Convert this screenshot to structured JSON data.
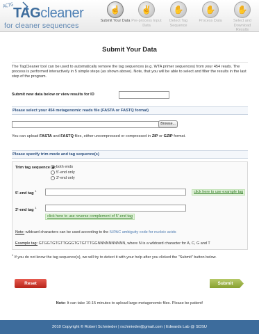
{
  "app": {
    "logo_seq": "ACTG",
    "logo_tag": "TAG",
    "logo_name": "cleaner",
    "logo_sub": "for cleaner sequences"
  },
  "steps": [
    {
      "label": "Submit Your Data",
      "icon": "hand-one-icon",
      "active": true
    },
    {
      "label": "Pre-process Input Data",
      "icon": "hand-two-icon",
      "active": false
    },
    {
      "label": "Detect Tag Sequence",
      "icon": "hand-three-icon",
      "active": false
    },
    {
      "label": "Process Data",
      "icon": "hand-four-icon",
      "active": false
    },
    {
      "label": "Select and Download Results",
      "icon": "hand-five-icon",
      "active": false
    }
  ],
  "page": {
    "title": "Submit Your Data",
    "intro": "The TagCleaner tool can be used to automatically remove the tag sequences (e.g. WTA primer sequences) from your 454 reads. The process is performed interactively in 5 simple steps (as shown above). Note, that you will be able to select and filter the results in the last step of the program.",
    "id_label": "Submit new data below or view results for ID",
    "id_value": ""
  },
  "file_section": {
    "header": "Please select your 454 metagenomic reads file (FASTA or FASTQ format)",
    "browse_label": "Browse...",
    "note_pre": "You can upload ",
    "note_fasta": "FASTA",
    "note_and": " and ",
    "note_fastq": "FASTQ",
    "note_mid": " files, either uncompressed or compressed in ",
    "note_zip": "ZIP",
    "note_or": " or ",
    "note_gzip": "GZIP",
    "note_end": " format."
  },
  "trim_section": {
    "header": "Please specify trim mode and tag sequence(s)",
    "trim_label": "Trim tag sequence at:",
    "options": [
      "both ends",
      "5'-end only",
      "3'-end only"
    ],
    "selected": "both ends",
    "tag5_label": "5'-end tag",
    "tag5_value": "",
    "tag5_link": "click here to use example tag",
    "tag3_label": "3'-end tag",
    "tag3_value": "",
    "tag3_link": "click here to use reverse complement of 5'-end tag",
    "footnote_mark": "1",
    "note_label": "Note:",
    "note_text": " wildcard characters can be used according to the ",
    "note_link": "IUPAC ambiguity code for nucleic acids",
    "example_label": "Example tag:",
    "example_text": " GTGGTGTGTTGGGTGTGTTTGGNNNNNNNNNN, where N is a wildcard character for A, C, G and T"
  },
  "footnote": " If you do not know the tag sequence(s), we will try to detect it with your help after you clicked the \"Submit\" button below.",
  "buttons": {
    "reset": "Reset",
    "submit": "Submit"
  },
  "bottom_note": {
    "label": "Note:",
    "text": " It can take 10-15 minutes to upload large metagenomic files. Please be patient!"
  },
  "footer": "2010 Copyright © Robert Schmieder | rschmieder@gmail.com | Edwards Lab @ SDSU",
  "colors": {
    "brand": "#3d6c9c",
    "reset": "#c9372c",
    "submit": "#9bb33f",
    "link_green": "#2b7a1e"
  }
}
